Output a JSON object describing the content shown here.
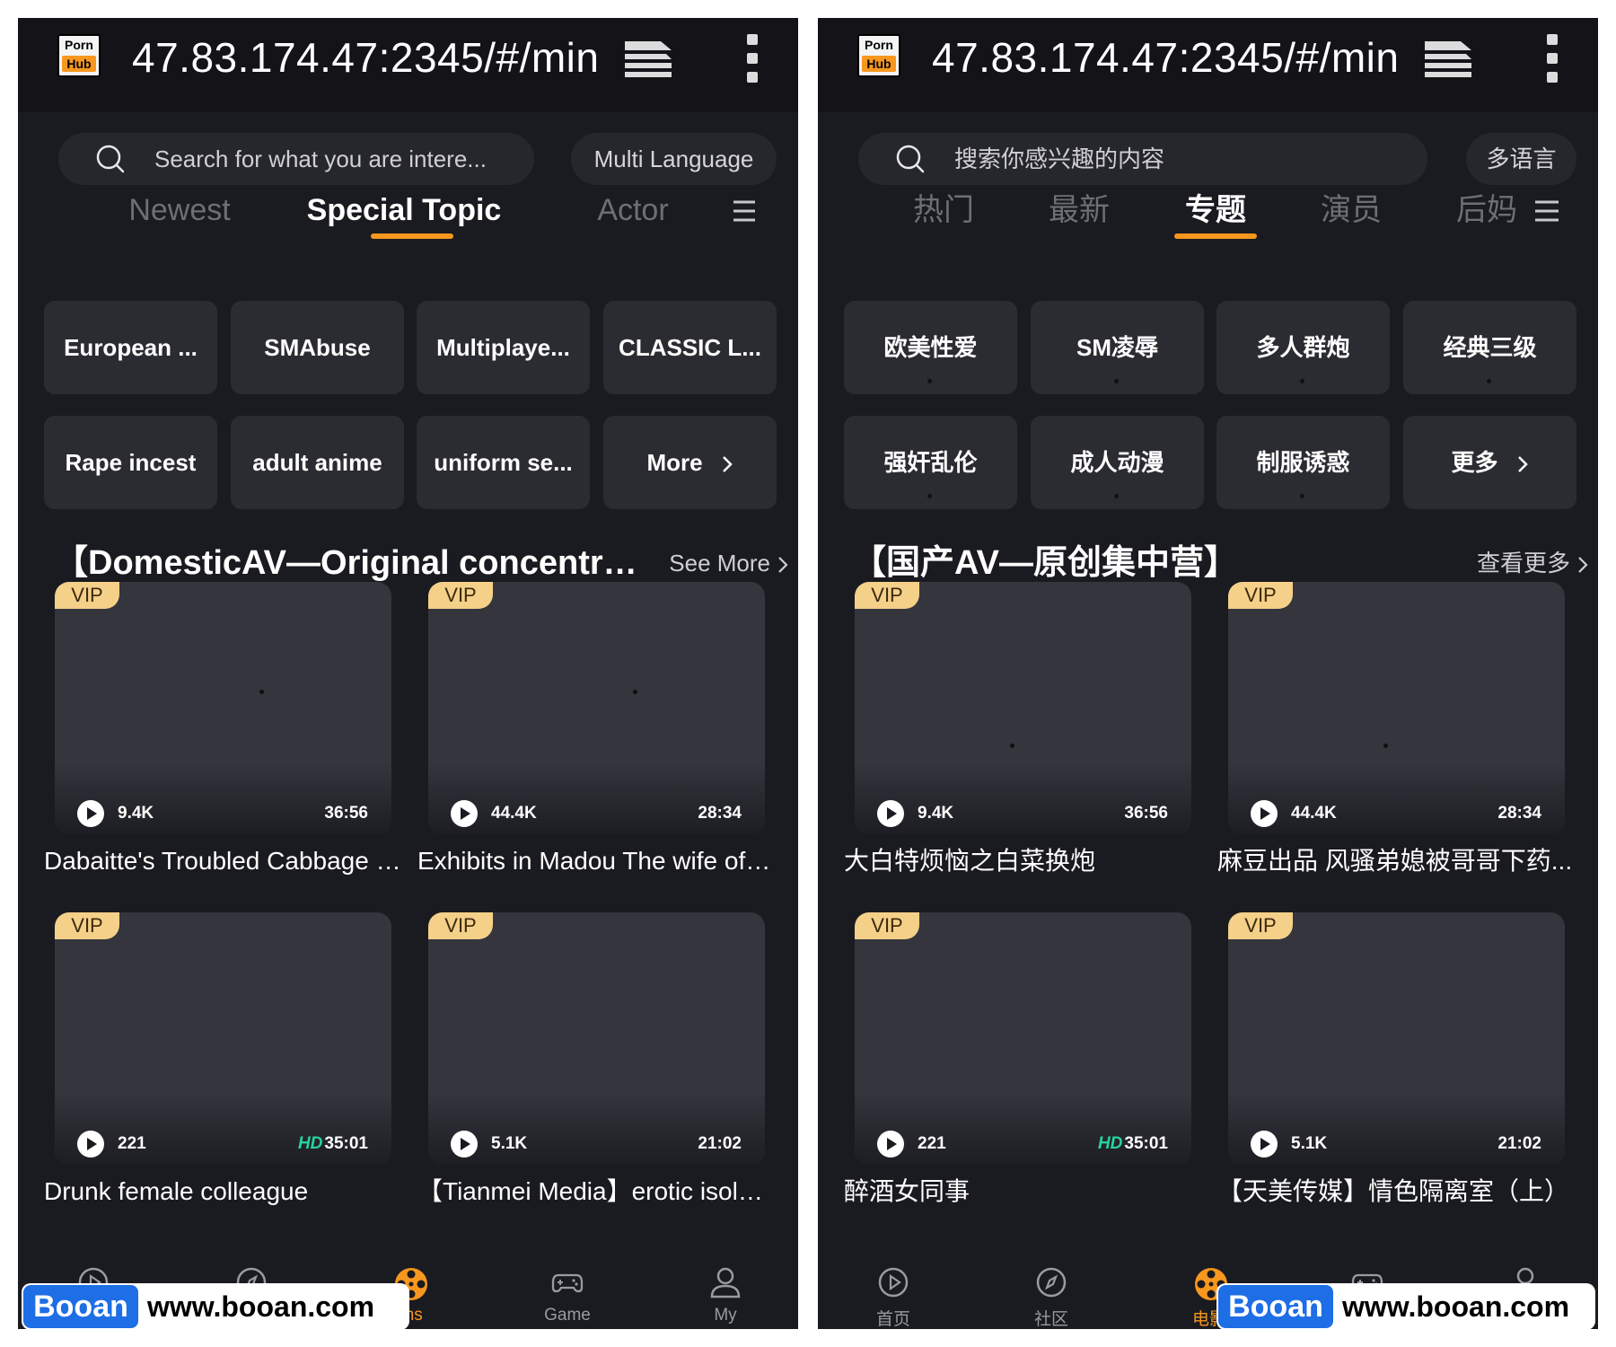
{
  "screens": [
    {
      "address_url": "47.83.174.47:2345/#/min",
      "logo": {
        "top": "Porn",
        "bottom": "Hub"
      },
      "search_placeholder": "Search for what you are intere...",
      "language_button": "Multi Language",
      "tabs": [
        {
          "label": "Newest",
          "active": false
        },
        {
          "label": "Special Topic",
          "active": true
        },
        {
          "label": "Actor",
          "active": false
        }
      ],
      "chips": [
        "European ...",
        "SMAbuse",
        "Multiplaye...",
        "CLASSIC L...",
        "Rape incest",
        "adult anime",
        "uniform se...",
        "More"
      ],
      "section_title": "【DomesticAV—Original concentrati...",
      "see_more": "See More",
      "videos": [
        {
          "badge": "VIP",
          "views": "9.4K",
          "hd": "",
          "duration": "36:56",
          "title": "Dabaitte's Troubled Cabbage C..."
        },
        {
          "badge": "VIP",
          "views": "44.4K",
          "hd": "",
          "duration": "28:34",
          "title": "Exhibits in Madou  The wife of t..."
        },
        {
          "badge": "VIP",
          "views": "221",
          "hd": "HD",
          "duration": "35:01",
          "title": "Drunk female colleague"
        },
        {
          "badge": "VIP",
          "views": "5.1K",
          "hd": "",
          "duration": "21:02",
          "title": "【Tianmei Media】erotic isolati..."
        }
      ],
      "nav": [
        {
          "label": "",
          "icon": "play-circle-icon",
          "active": false
        },
        {
          "label": "",
          "icon": "compass-icon",
          "active": false
        },
        {
          "label": "lms",
          "icon": "film-reel-icon",
          "active": true
        },
        {
          "label": "Game",
          "icon": "gamepad-icon",
          "active": false
        },
        {
          "label": "My",
          "icon": "user-icon",
          "active": false
        }
      ],
      "watermark": {
        "brand": "Booan",
        "url": "www.booan.com"
      }
    },
    {
      "address_url": "47.83.174.47:2345/#/min",
      "logo": {
        "top": "Porn",
        "bottom": "Hub"
      },
      "search_placeholder": "搜索你感兴趣的内容",
      "language_button": "多语言",
      "tabs": [
        {
          "label": "热门",
          "active": false
        },
        {
          "label": "最新",
          "active": false
        },
        {
          "label": "专题",
          "active": true
        },
        {
          "label": "演员",
          "active": false
        },
        {
          "label": "后妈",
          "active": false
        }
      ],
      "chips": [
        "欧美性爱",
        "SM凌辱",
        "多人群炮",
        "经典三级",
        "强奸乱伦",
        "成人动漫",
        "制服诱惑",
        "更多"
      ],
      "section_title": "【国产AV—原创集中营】",
      "see_more": "查看更多",
      "videos": [
        {
          "badge": "VIP",
          "views": "9.4K",
          "hd": "",
          "duration": "36:56",
          "title": "大白特烦恼之白菜换炮"
        },
        {
          "badge": "VIP",
          "views": "44.4K",
          "hd": "",
          "duration": "28:34",
          "title": "麻豆出品  风骚弟媳被哥哥下药..."
        },
        {
          "badge": "VIP",
          "views": "221",
          "hd": "HD",
          "duration": "35:01",
          "title": "醉酒女同事"
        },
        {
          "badge": "VIP",
          "views": "5.1K",
          "hd": "",
          "duration": "21:02",
          "title": "【天美传媒】情色隔离室（上）"
        }
      ],
      "nav": [
        {
          "label": "首页",
          "icon": "play-circle-icon",
          "active": false
        },
        {
          "label": "社区",
          "icon": "compass-icon",
          "active": false
        },
        {
          "label": "电影",
          "icon": "film-reel-icon",
          "active": true
        },
        {
          "label": "",
          "icon": "gamepad-icon",
          "active": false
        },
        {
          "label": "",
          "icon": "user-icon",
          "active": false
        }
      ],
      "watermark": {
        "brand": "Booan",
        "url": "www.booan.com"
      }
    }
  ],
  "colors": {
    "accent": "#f7971e",
    "background": "#1a1b20",
    "chip": "#2b2c32",
    "card": "#34353d",
    "vip": "#f5d089",
    "hd": "#27d3a0",
    "watermark_blue": "#1e6ee6"
  }
}
